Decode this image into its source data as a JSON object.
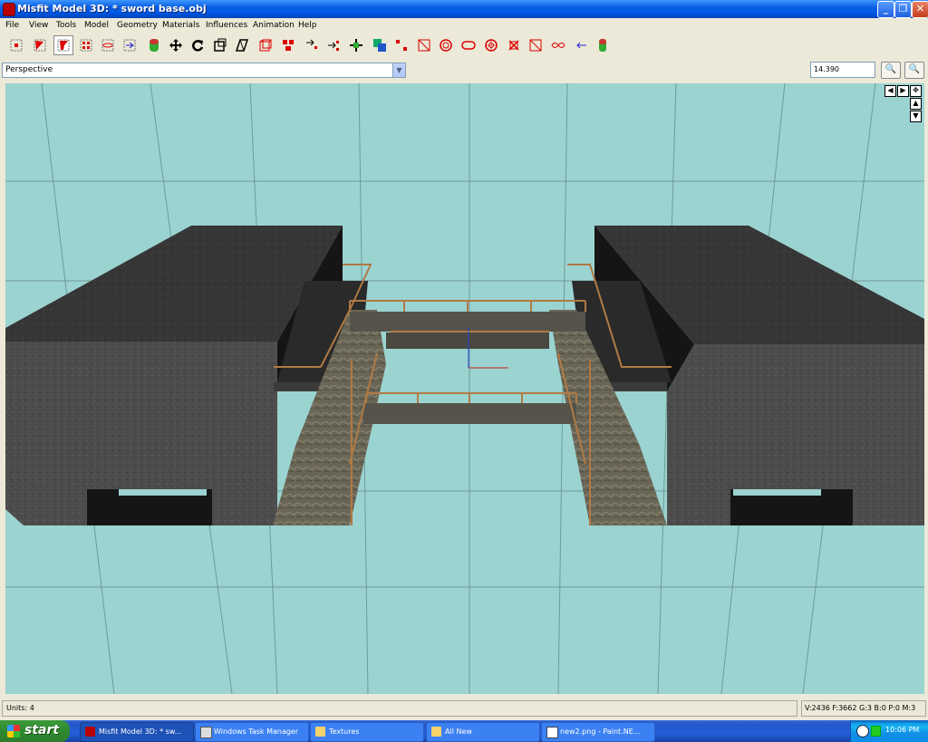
{
  "window": {
    "title": "Misfit Model 3D: * sword base.obj",
    "controls": {
      "minimize": "_",
      "restore": "❐",
      "close": "✕"
    }
  },
  "menu": [
    "File",
    "View",
    "Tools",
    "Model",
    "Geometry",
    "Materials",
    "Influences",
    "Animation",
    "Help"
  ],
  "toolbar": {
    "tools": [
      {
        "name": "select-vertices-tool",
        "active": false
      },
      {
        "name": "select-faces-tool",
        "active": false
      },
      {
        "name": "select-connected-tool",
        "active": true
      },
      {
        "name": "select-groups-tool",
        "active": false
      },
      {
        "name": "select-bones-tool",
        "active": false
      },
      {
        "name": "select-points-tool",
        "active": false
      },
      {
        "name": "select-projections-tool",
        "active": false
      },
      {
        "name": "move-tool",
        "active": false
      },
      {
        "name": "rotate-tool",
        "active": false
      },
      {
        "name": "scale-tool",
        "active": false
      },
      {
        "name": "shear-tool",
        "active": false
      },
      {
        "name": "extrude-tool",
        "active": false
      },
      {
        "name": "attach-tool",
        "active": false
      },
      {
        "name": "bone-tool",
        "active": false
      },
      {
        "name": "point-tool",
        "active": false
      },
      {
        "name": "create-vertex-tool",
        "active": false
      },
      {
        "name": "create-rect-tool",
        "active": false
      },
      {
        "name": "create-cube-tool",
        "active": false
      },
      {
        "name": "create-ellipsoid-tool",
        "active": false
      },
      {
        "name": "create-cylinder-tool",
        "active": false
      },
      {
        "name": "create-torus-tool",
        "active": false
      },
      {
        "name": "create-polygon-tool",
        "active": false
      },
      {
        "name": "create-projection-tool",
        "active": false
      },
      {
        "name": "background-tool",
        "active": false
      },
      {
        "name": "drag-vertex-tool",
        "active": false
      },
      {
        "name": "paint-texture-tool",
        "active": false
      }
    ]
  },
  "viewbar": {
    "view_mode": "Perspective",
    "zoom_value": "14.390",
    "zoom_in": "🔍",
    "zoom_out": "🔍"
  },
  "viewport": {
    "nav": {
      "left": "◀",
      "right": "▶",
      "pan": "✥",
      "up": "▲",
      "down": "▼"
    },
    "colors": {
      "background": "#9bd3d1",
      "grid": "#6f9a99",
      "block_top": "#3a3a3a",
      "block_side": "#4a4a4a",
      "shadow": "#111111",
      "ramp": "#6e6a5a",
      "rail": "#b07a44",
      "bridge": "#55534a"
    }
  },
  "status": {
    "units": "Units: 4",
    "stats": "V:2436 F:3662 G:3 B:0 P:0 M:3"
  },
  "taskbar": {
    "start": "start",
    "tasks": [
      {
        "label": "Misfit Model 3D: * sw...",
        "icon": "misfit-icon",
        "active": true
      },
      {
        "label": "Windows Task Manager",
        "icon": "task-manager-icon",
        "active": false
      },
      {
        "label": "Textures",
        "icon": "folder-icon",
        "active": false
      },
      {
        "label": "All New",
        "icon": "folder-icon",
        "active": false
      },
      {
        "label": "new2.png - Paint.NE...",
        "icon": "paint-icon",
        "active": false
      }
    ],
    "clock": "10:06 PM"
  }
}
